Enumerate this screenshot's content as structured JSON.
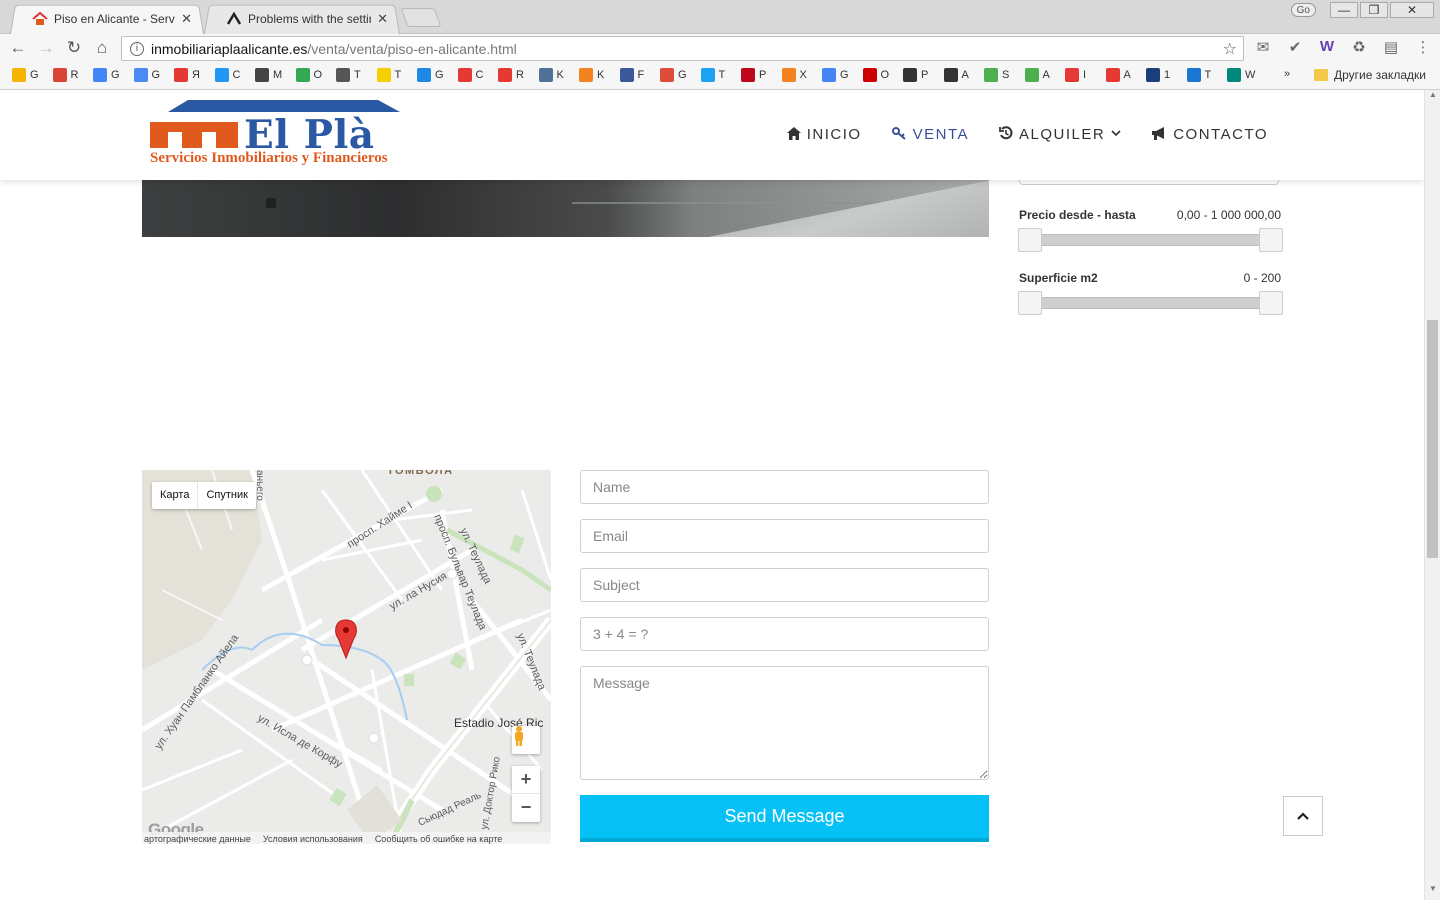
{
  "browser": {
    "tabs": [
      {
        "title": "Piso en Alicante - Servicios Inmobiliarios y Financieros",
        "active": true
      },
      {
        "title": "Problems with the settings",
        "active": false
      }
    ],
    "profile_badge": "Go",
    "url_host": "inmobiliariaplaalicante.es",
    "url_path": "/venta/venta/piso-en-alicante.html",
    "bookmarks": [
      "G",
      "R",
      "G",
      "G",
      "Я",
      "C",
      "M",
      "O",
      "T",
      "T",
      "G",
      "C",
      "R",
      "K",
      "K",
      "F",
      "G",
      "T",
      "P",
      "X",
      "G",
      "O",
      "P",
      "A",
      "S",
      "A",
      "I",
      "A",
      "1",
      "T",
      "W"
    ],
    "bookmarks_more": "»",
    "other_bookmarks": "Другие закладки"
  },
  "header": {
    "logo_text": "El Plà",
    "logo_subtitle": "Servicios Inmobiliarios y Financieros",
    "nav": [
      {
        "label": "INICIO",
        "icon": "home-icon"
      },
      {
        "label": "VENTA",
        "icon": "key-icon",
        "active": true
      },
      {
        "label": "ALQUILER",
        "icon": "history-icon",
        "dropdown": true
      },
      {
        "label": "CONTACTO",
        "icon": "bullhorn-icon"
      }
    ]
  },
  "filters": {
    "price": {
      "label": "Precio desde - hasta",
      "value": "0,00 - 1 000 000,00"
    },
    "area": {
      "label": "Superficie m2",
      "value": "0 - 200"
    }
  },
  "map": {
    "type_buttons": [
      "Карта",
      "Спутник"
    ],
    "street_labels": [
      "ТОМБОЛА",
      "просп. Хайме I",
      "ул. Теулада",
      "просп. Бульвар Теулада",
      "ул. ла Нусия",
      "ул. Хуан Памбланко Айела",
      "ул. Исла де Корфу",
      "Estadio José Ric",
      "ул. Теулада",
      "Сьюдад Реаль",
      "ул. Доктор Рико",
      "аньего"
    ],
    "zoom_in": "+",
    "zoom_out": "−",
    "google": "Google",
    "footer": [
      "артографические данные",
      "Условия использования",
      "Сообщить об ошибке на карте"
    ]
  },
  "form": {
    "name_placeholder": "Name",
    "email_placeholder": "Email",
    "subject_placeholder": "Subject",
    "captcha_placeholder": "3 + 4 = ?",
    "message_placeholder": "Message",
    "send_label": "Send Message"
  },
  "colors": {
    "accent": "#06c1f6",
    "logo_blue": "#2b58a3",
    "logo_orange": "#e05a1e",
    "nav_active": "#3a4f9a"
  }
}
